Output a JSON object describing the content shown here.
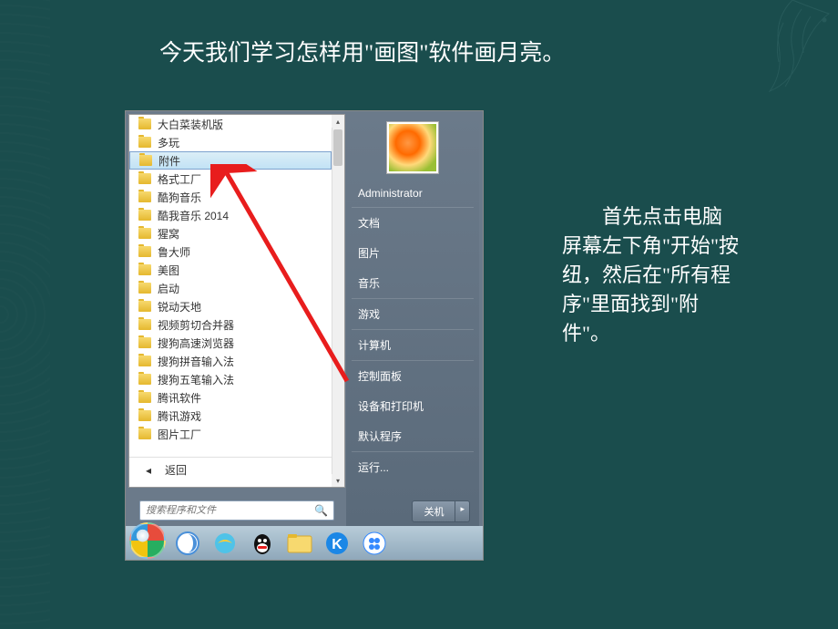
{
  "heading": "今天我们学习怎样用\"画图\"软件画月亮。",
  "instruction": "首先点击电脑屏幕左下角\"开始\"按纽，然后在\"所有程序\"里面找到\"附件\"。",
  "startMenu": {
    "programs": [
      "大白菜装机版",
      "多玩",
      "附件",
      "格式工厂",
      "酷狗音乐",
      "酷我音乐 2014",
      "猩窝",
      "鲁大师",
      "美图",
      "启动",
      "锐动天地",
      "视频剪切合并器",
      "搜狗高速浏览器",
      "搜狗拼音输入法",
      "搜狗五笔输入法",
      "腾讯软件",
      "腾讯游戏",
      "图片工厂"
    ],
    "selectedIndex": 2,
    "backLabel": "返回",
    "searchPlaceholder": "搜索程序和文件",
    "userName": "Administrator",
    "rightItems": [
      "文档",
      "图片",
      "音乐",
      "游戏",
      "计算机",
      "控制面板",
      "设备和打印机",
      "默认程序",
      "运行..."
    ],
    "shutdownLabel": "关机"
  },
  "taskbar": {
    "items": [
      "start",
      "browser-sogou",
      "browser-ie",
      "qq",
      "folder",
      "kugou",
      "baidu"
    ]
  }
}
